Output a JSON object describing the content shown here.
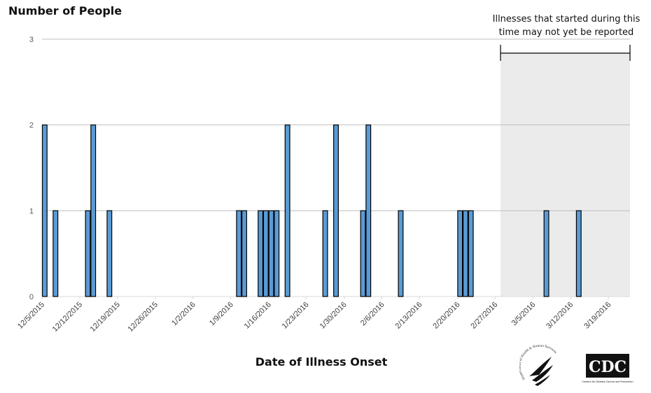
{
  "chart_data": {
    "type": "bar",
    "title": "",
    "ylabel": "Number of People",
    "xlabel": "Date of Illness Onset",
    "ylim": [
      0,
      3
    ],
    "yticks": [
      0,
      1,
      2,
      3
    ],
    "grid": true,
    "x_start_date": "2015-12-05",
    "x_end_date": "2016-03-23",
    "xtick_labels": [
      "12/5/2015",
      "12/12/2015",
      "12/19/2015",
      "12/26/2015",
      "1/2/2016",
      "1/9/2016",
      "1/16/2016",
      "1/23/2016",
      "1/30/2016",
      "2/6/2016",
      "2/13/2016",
      "2/20/2016",
      "2/27/2016",
      "3/5/2016",
      "3/12/2016",
      "3/19/2016"
    ],
    "series": [
      {
        "name": "Number of People",
        "color": "#5b9bd5",
        "edge_color": "#000000",
        "points": [
          {
            "date": "12/5/2015",
            "value": 2
          },
          {
            "date": "12/7/2015",
            "value": 1
          },
          {
            "date": "12/13/2015",
            "value": 1
          },
          {
            "date": "12/14/2015",
            "value": 2
          },
          {
            "date": "12/17/2015",
            "value": 1
          },
          {
            "date": "1/10/2016",
            "value": 1
          },
          {
            "date": "1/11/2016",
            "value": 1
          },
          {
            "date": "1/14/2016",
            "value": 1
          },
          {
            "date": "1/15/2016",
            "value": 1
          },
          {
            "date": "1/16/2016",
            "value": 1
          },
          {
            "date": "1/17/2016",
            "value": 1
          },
          {
            "date": "1/19/2016",
            "value": 2
          },
          {
            "date": "1/26/2016",
            "value": 1
          },
          {
            "date": "1/28/2016",
            "value": 2
          },
          {
            "date": "2/2/2016",
            "value": 1
          },
          {
            "date": "2/3/2016",
            "value": 2
          },
          {
            "date": "2/9/2016",
            "value": 1
          },
          {
            "date": "2/20/2016",
            "value": 1
          },
          {
            "date": "2/21/2016",
            "value": 1
          },
          {
            "date": "2/22/2016",
            "value": 1
          },
          {
            "date": "3/7/2016",
            "value": 1
          },
          {
            "date": "3/13/2016",
            "value": 1
          }
        ]
      }
    ],
    "shaded_region": {
      "start_date": "2/28/2016",
      "end_date": "3/23/2016",
      "color": "#ebebeb",
      "annotation": "Illnesses that started during this time may not yet be reported"
    }
  },
  "labels": {
    "y_title": "Number of People",
    "x_title": "Date of Illness Onset",
    "note": "Illnesses that started during this time may not yet be reported"
  },
  "logos": {
    "hhs": "Department of Health & Human Services USA",
    "cdc": "CDC",
    "cdc_sub": "Centers for Disease Control and Prevention"
  }
}
